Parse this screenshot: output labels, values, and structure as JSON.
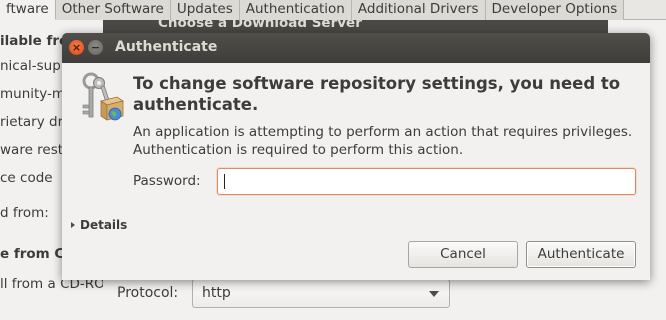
{
  "background_window": {
    "tabs": [
      {
        "label": "ftware"
      },
      {
        "label": "Other Software"
      },
      {
        "label": "Updates"
      },
      {
        "label": "Authentication"
      },
      {
        "label": "Additional Drivers"
      },
      {
        "label": "Developer Options"
      }
    ],
    "fragments": {
      "available_from": "ilable from",
      "canonical": "nical-sup",
      "community": "munity-m",
      "proprietary": "rietary dr",
      "restricted": "ware restr",
      "source_code": "ce code",
      "download_from": "d from:",
      "install_from_cd": "e from C",
      "cd_rom": "ll from a CD-RO"
    }
  },
  "server_dialog": {
    "title": "Choose a Download Server",
    "protocol_label": "Protocol:",
    "protocol_value": "http"
  },
  "auth_dialog": {
    "title": "Authenticate",
    "close_symbol": "×",
    "minimize_symbol": "−",
    "heading": "To change software repository settings, you need to authenticate.",
    "description": "An application is attempting to perform an action that requires privileges. Authentication is required to perform this action.",
    "password_label": "Password:",
    "password_value": "",
    "details_label": "Details",
    "cancel_label": "Cancel",
    "authenticate_label": "Authenticate"
  },
  "colors": {
    "titlebar": "#3e3d39",
    "focus_border": "#e08a5e",
    "window_bg": "#f2f1f0"
  }
}
